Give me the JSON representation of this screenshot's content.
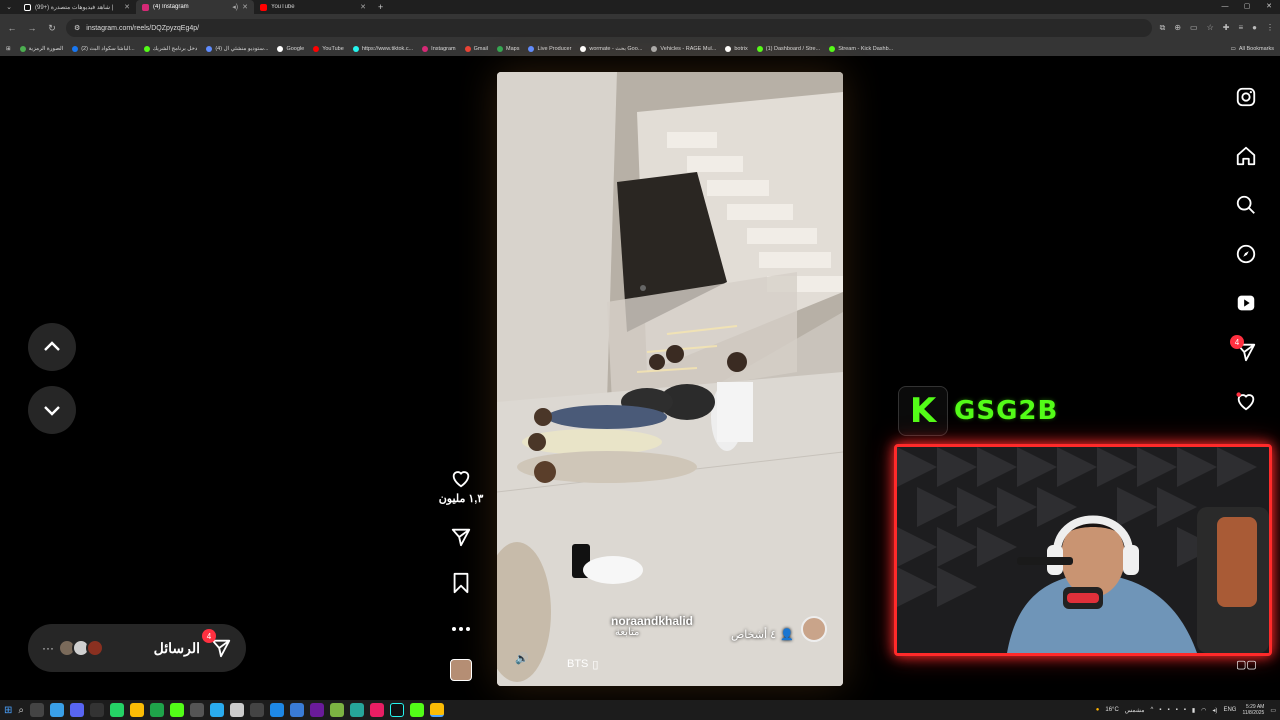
{
  "browser": {
    "tabs": [
      {
        "title": "(99+) شاهد فيديوهات متصدرة |",
        "favicon_color": "#ffffff",
        "active": false
      },
      {
        "title": "(4) Instagram",
        "favicon_color": "#d62976",
        "active": true
      },
      {
        "title": "YouTube",
        "favicon_color": "#ff0000",
        "active": false
      }
    ],
    "url": "instagram.com/reels/DQZpyzqEg4p/",
    "bookmarks": [
      {
        "label": "الصورة الرمزية",
        "color": "#4caf50"
      },
      {
        "label": "(2) الباشا سكواد البث...",
        "color": "#1877f2"
      },
      {
        "label": "دخل برنامج الشريك",
        "color": "#53fc18"
      },
      {
        "label": "(4) ستوديو منشئي ال...",
        "color": "#5f8cff"
      },
      {
        "label": "Google",
        "color": "#ffffff"
      },
      {
        "label": "YouTube",
        "color": "#ff0000"
      },
      {
        "label": "https://www.tiktok.c...",
        "color": "#25f4ee"
      },
      {
        "label": "Instagram",
        "color": "#d62976"
      },
      {
        "label": "Gmail",
        "color": "#ea4335"
      },
      {
        "label": "Maps",
        "color": "#34a853"
      },
      {
        "label": "Live Producer",
        "color": "#5f8cff"
      },
      {
        "label": "wormate - بحث Goo...",
        "color": "#ffffff"
      },
      {
        "label": "Vehicles - RAGE Mul...",
        "color": "#aaaaaa"
      },
      {
        "label": "botrix",
        "color": "#ffffff"
      },
      {
        "label": "(1) Dashboard / Stre...",
        "color": "#53fc18"
      },
      {
        "label": "Stream - Kick Dashb...",
        "color": "#53fc18"
      }
    ],
    "all_bookmarks": "All Bookmarks"
  },
  "reel": {
    "owner": "noraandkhalid",
    "follow_label": "متابعة",
    "people_label": "٤ أشخاص",
    "audio_label": "BTS",
    "likes": "١,٣ مليون"
  },
  "messages": {
    "label": "الرسائل",
    "badge": "4"
  },
  "sidenav": {
    "messages_badge": "4"
  },
  "overlay": {
    "kick_letter": "K",
    "channel_name": "GSG2B"
  },
  "taskbar": {
    "weather": "16°C",
    "weather_label": "مشمس",
    "lang": "ENG",
    "time": "5:29 AM",
    "date": "11/8/2025"
  }
}
